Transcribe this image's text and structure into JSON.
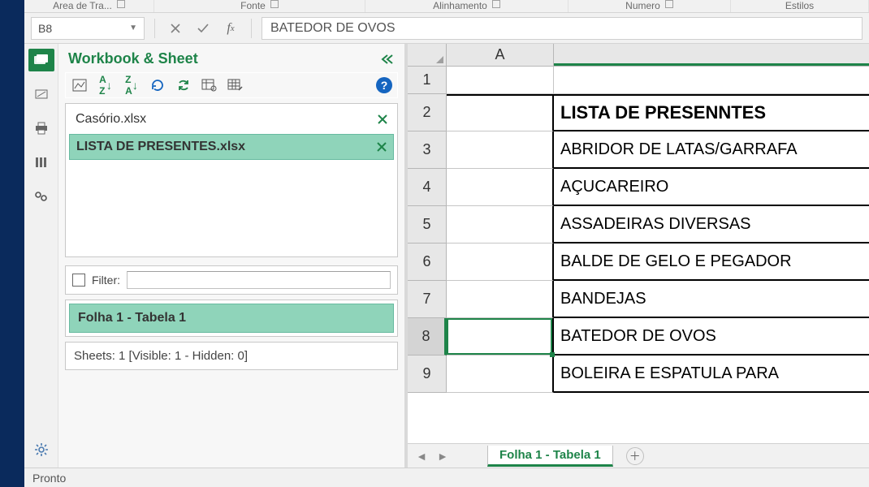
{
  "ribbon_groups": {
    "g1": "Area de Tra...",
    "g2": "Fonte",
    "g3": "Alinhamento",
    "g4": "Numero",
    "g5": "Estilos"
  },
  "name_box": "B8",
  "formula_value": "BATEDOR DE OVOS",
  "panel": {
    "title": "Workbook & Sheet",
    "workbooks": [
      {
        "name": "Casório.xlsx",
        "active": false
      },
      {
        "name": "LISTA DE PRESENTES.xlsx",
        "active": true
      }
    ],
    "filter_label": "Filter:",
    "sheet_item": "Folha 1 - Tabela 1",
    "stats": "Sheets: 1  [Visible: 1 - Hidden: 0]"
  },
  "grid": {
    "col_A": "A",
    "rows": [
      {
        "n": "1",
        "A": "",
        "rest": "",
        "kind": "r1"
      },
      {
        "n": "2",
        "A": "",
        "rest": "LISTA DE PRESENNTES",
        "kind": "header"
      },
      {
        "n": "3",
        "A": "",
        "rest": "ABRIDOR DE LATAS/GARRAFA"
      },
      {
        "n": "4",
        "A": "",
        "rest": "AÇUCAREIRO"
      },
      {
        "n": "5",
        "A": "",
        "rest": "ASSADEIRAS DIVERSAS"
      },
      {
        "n": "6",
        "A": "",
        "rest": "BALDE DE GELO E PEGADOR"
      },
      {
        "n": "7",
        "A": "",
        "rest": "BANDEJAS"
      },
      {
        "n": "8",
        "A": "",
        "rest": "BATEDOR DE OVOS",
        "selected": true
      },
      {
        "n": "9",
        "A": "",
        "rest": "BOLEIRA  E ESPATULA PARA "
      }
    ]
  },
  "sheet_tab": "Folha 1 - Tabela 1",
  "status": "Pronto"
}
